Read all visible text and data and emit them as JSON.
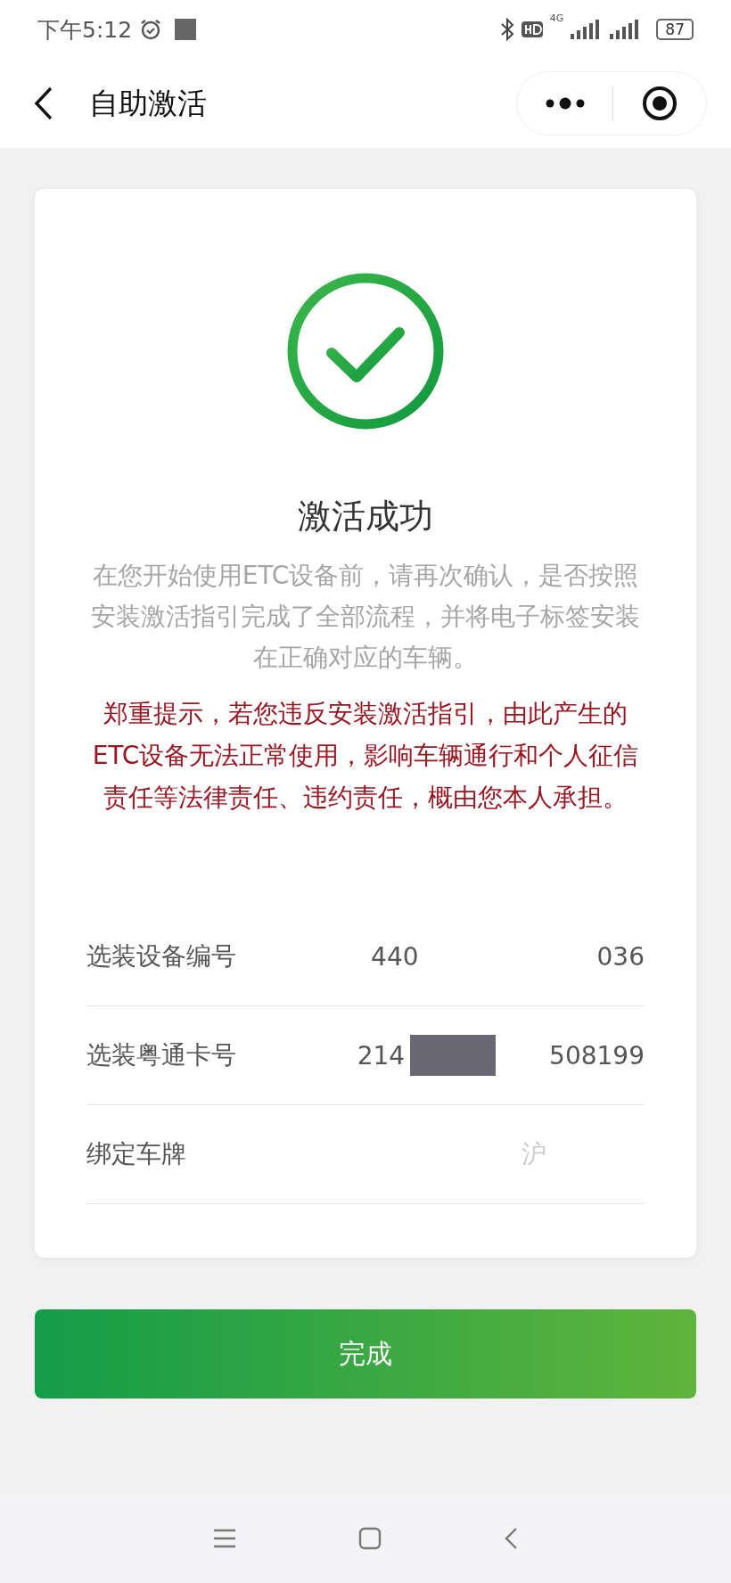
{
  "status_bar": {
    "time": "下午5:12",
    "network": "4G",
    "battery": "87"
  },
  "nav": {
    "title": "自助激活"
  },
  "result": {
    "title": "激活成功",
    "notice": "在您开始使用ETC设备前，请再次确认，是否按照安装激活指引完成了全部流程，并将电子标签安装在正确对应的车辆。",
    "warning": "郑重提示，若您违反安装激活指引，由此产生的ETC设备无法正常使用，影响车辆通行和个人征信责任等法律责任、违约责任，概由您本人承担。"
  },
  "rows": [
    {
      "label": "选装设备编号",
      "value_parts": [
        "440",
        "036"
      ],
      "kind": "blank"
    },
    {
      "label": "选装粤通卡号",
      "value_parts": [
        "214",
        "508199"
      ],
      "kind": "block"
    },
    {
      "label": "绑定车牌",
      "value_parts": [
        "沪"
      ],
      "kind": "faded"
    }
  ],
  "button": {
    "label": "完成"
  }
}
